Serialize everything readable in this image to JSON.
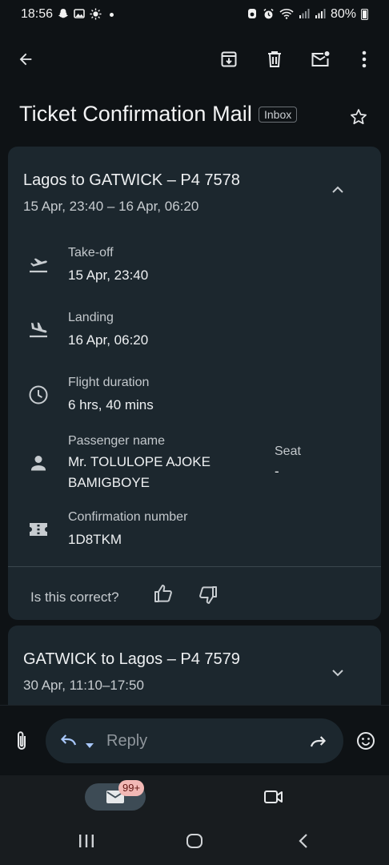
{
  "status_bar": {
    "time": "18:56",
    "battery": "80%"
  },
  "subject": {
    "title": "Ticket Confirmation Mail",
    "label": "Inbox"
  },
  "trips": [
    {
      "title": "Lagos to GATWICK – P4 7578",
      "subtitle": "15 Apr, 23:40 – 16 Apr, 06:20",
      "details": {
        "takeoff_label": "Take-off",
        "takeoff_value": "15 Apr, 23:40",
        "landing_label": "Landing",
        "landing_value": "16 Apr, 06:20",
        "duration_label": "Flight duration",
        "duration_value": "6 hrs, 40 mins",
        "passenger_label": "Passenger name",
        "passenger_line1": "Mr. TOLULOPE AJOKE",
        "passenger_line2": "BAMIGBOYE",
        "seat_label": "Seat",
        "seat_value": "-",
        "confirmation_label": "Confirmation number",
        "confirmation_value": "1D8TKM"
      },
      "feedback_question": "Is this correct?"
    },
    {
      "title": "GATWICK to Lagos – P4 7579",
      "subtitle": "30 Apr, 11:10–17:50"
    }
  ],
  "reply": {
    "placeholder": "Reply"
  },
  "bottom_nav": {
    "mail_badge": "99+"
  },
  "colors": {
    "background": "#0e1215",
    "card": "#1c272e",
    "badge": "#f2b8b5"
  }
}
